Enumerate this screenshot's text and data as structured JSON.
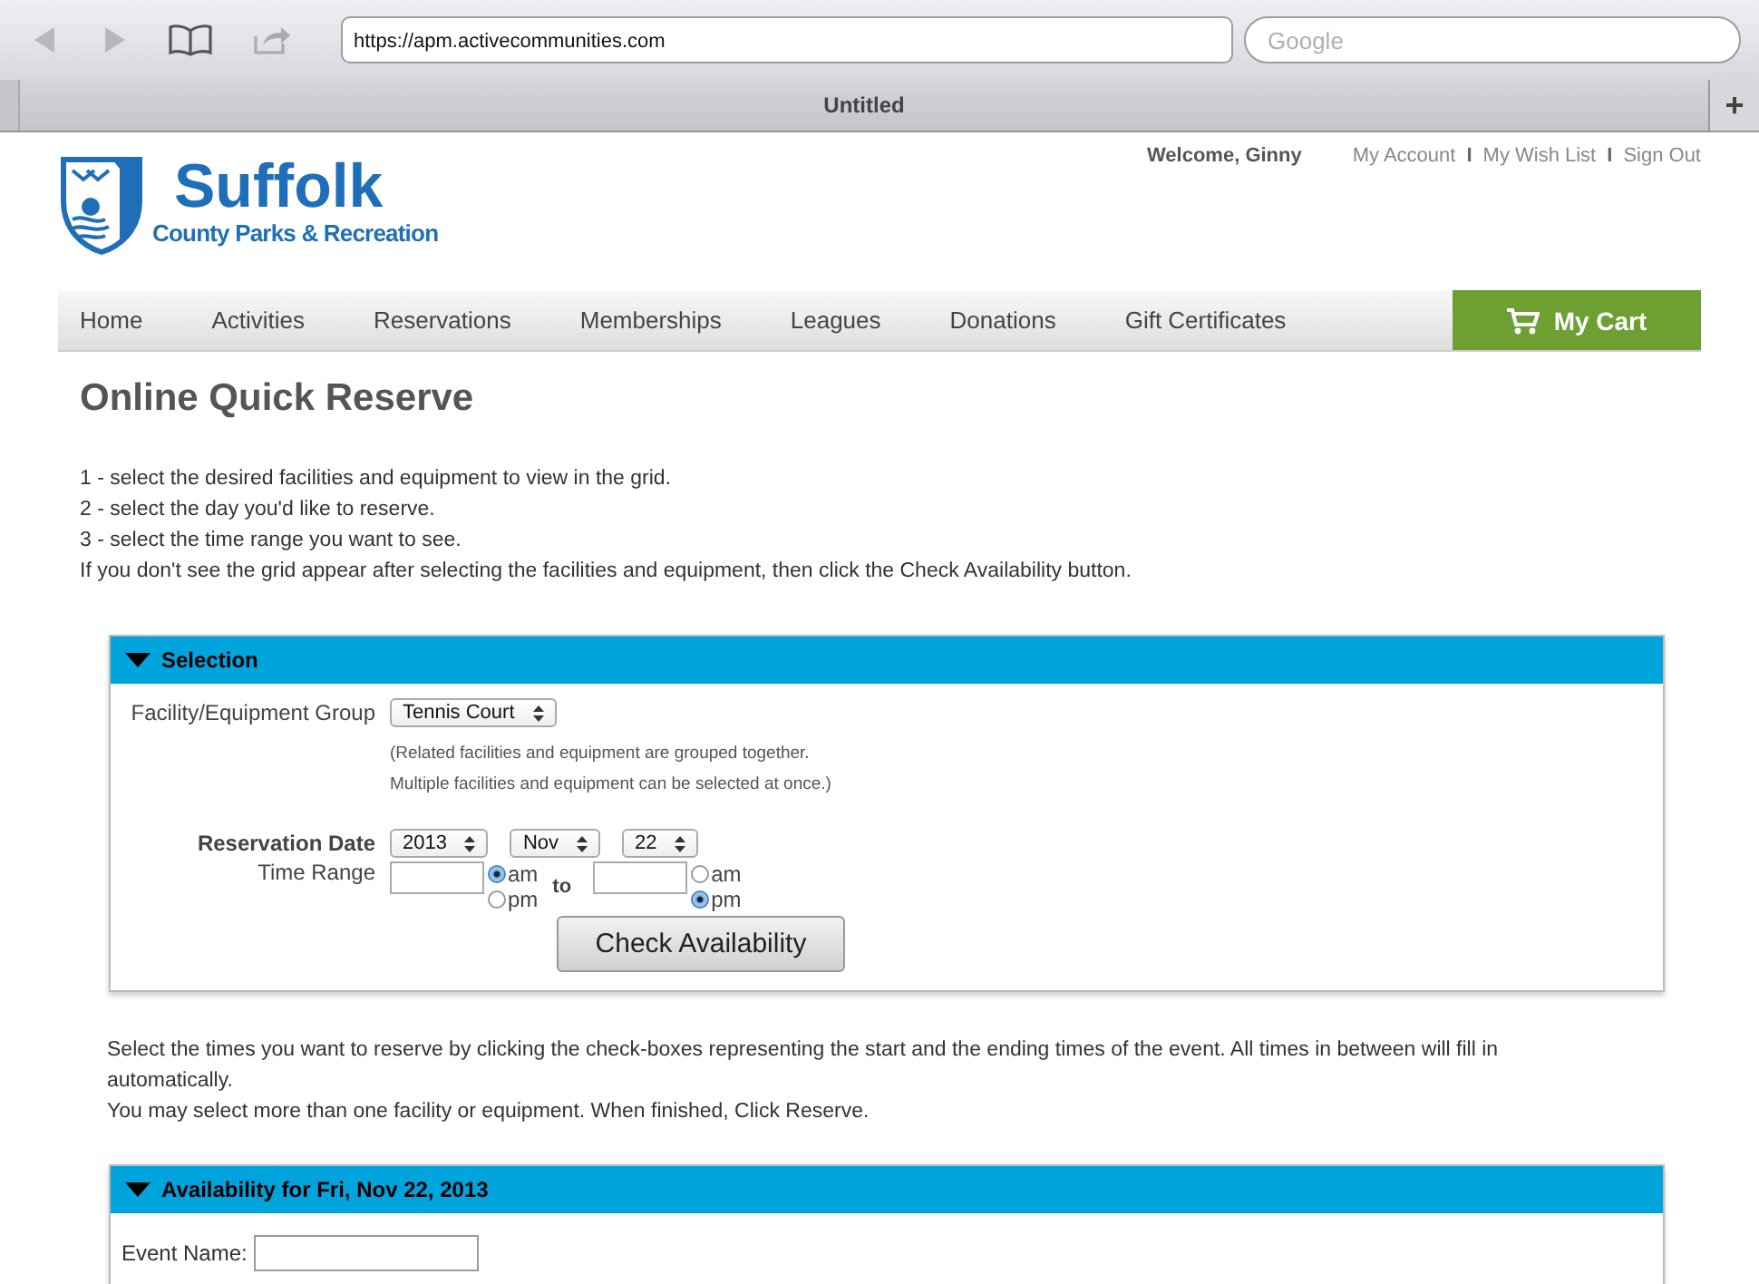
{
  "browser": {
    "url": "https://apm.activecommunities.com",
    "search_placeholder": "Google",
    "tab_title": "Untitled",
    "new_tab": "+"
  },
  "header": {
    "logo_title": "Suffolk",
    "logo_subtitle": "County Parks & Recreation",
    "welcome": "Welcome, Ginny",
    "user_links": [
      "My Account",
      "My Wish List",
      "Sign Out"
    ],
    "separators": [
      "I",
      "I"
    ]
  },
  "nav": {
    "items": [
      "Home",
      "Activities",
      "Reservations",
      "Memberships",
      "Leagues",
      "Donations",
      "Gift Certificates"
    ],
    "cart": "My Cart"
  },
  "page_title": "Online Quick Reserve",
  "instructions": [
    "1 - select the desired facilities and equipment to view in the grid.",
    "2 - select the day you'd like to reserve.",
    "3 - select the time range you want to see.",
    "If you don't see the grid appear after selecting the facilities and equipment, then click the Check Availability button."
  ],
  "selection": {
    "title": "Selection",
    "group_label": "Facility/Equipment Group",
    "group_value": "Tennis Court",
    "hints": [
      "(Related facilities and equipment are grouped together.",
      "Multiple facilities and equipment can be selected at once.)"
    ],
    "date_label": "Reservation Date",
    "date_values": [
      "2013",
      "Nov",
      "22"
    ],
    "time_label": "Time Range",
    "to_label": "to",
    "time_from": [
      {
        "label": "am",
        "selected": true
      },
      {
        "label": "pm",
        "selected": false
      }
    ],
    "time_to": [
      {
        "label": "am",
        "selected": false
      },
      {
        "label": "pm",
        "selected": true
      }
    ],
    "button": "Check Availability"
  },
  "notes": [
    "Select the times you want to reserve by clicking the check-boxes representing the start and the ending times of the event. All times in between will fill in automatically.",
    "You may select more than one facility or equipment. When finished, Click Reserve."
  ],
  "availability": {
    "title": "Availability for Fri, Nov 22, 2013",
    "event_label": "Event Name:"
  }
}
